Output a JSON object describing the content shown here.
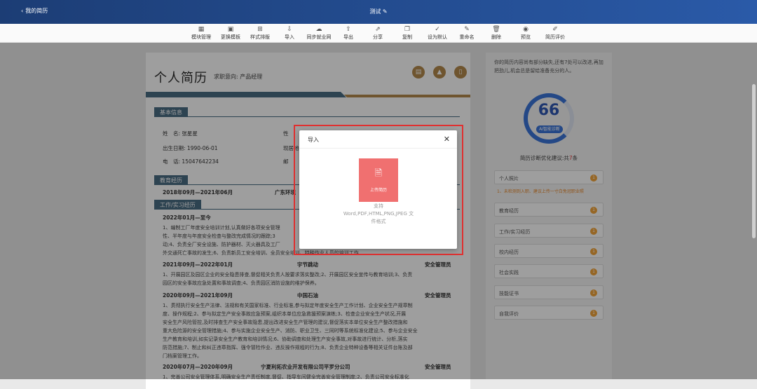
{
  "topbar": {
    "back_label": "我的简历",
    "title": "测试"
  },
  "toolbar": {
    "items": [
      {
        "label": "模块管理",
        "icon": "grid-icon"
      },
      {
        "label": "更换模板",
        "icon": "template-icon"
      },
      {
        "label": "样式排版",
        "icon": "layout-icon"
      },
      {
        "label": "导入",
        "icon": "import-icon"
      },
      {
        "label": "同步就业网",
        "icon": "cloud-sync-icon"
      },
      {
        "label": "导出",
        "icon": "export-icon"
      },
      {
        "label": "分享",
        "icon": "share-icon"
      },
      {
        "label": "复制",
        "icon": "copy-icon"
      },
      {
        "label": "设为默认",
        "icon": "check-icon"
      },
      {
        "label": "重命名",
        "icon": "rename-icon"
      },
      {
        "label": "删除",
        "icon": "delete-icon"
      },
      {
        "label": "预览",
        "icon": "eye-icon"
      },
      {
        "label": "简历评价",
        "icon": "edit-icon"
      }
    ]
  },
  "resume": {
    "name": "个人简历",
    "intent_label": "求职意向:",
    "intent_value": "产品经理",
    "basic_title": "基本信息",
    "name_label": "姓　名:",
    "name_value": "张星星",
    "gender_label": "性",
    "birth_label": "出生日期:",
    "birth_value": "1990-06-01",
    "residence_label": "现居地",
    "phone_label": "电　话:",
    "phone_value": "15047642234",
    "email_label": "邮",
    "edu_title": "教育经历",
    "edu_date": "2018年09月—2021年06月",
    "edu_school": "广东环境",
    "work_title": "工作/实习经历",
    "jobs": [
      {
        "date": "2022年01月—至今",
        "company": "",
        "role": "",
        "lines": [
          "1、编制工厂年度安全培训计划,认真做好各项安全管理",
          "性、半年度与年度安全检查与整改完成情况的跟踪;3",
          "动;4、负责全厂安全设施、防护器材、灭火器具及工厂",
          "外交通死亡事故的发生;6、负责新员工安全培训、全员安全培训、特种作业人员的培训工作"
        ]
      },
      {
        "date": "2021年09月—2022年01月",
        "company": "宇节跳动",
        "role": "安全管理员",
        "lines": [
          "1、开展园区及园区企业的安全隐患排查,督促相关负责人按要求落实整改;2、开展园区安全宣传与教育培训;3、负责",
          "园区的安全事故应急处置和事故调查;4、负责园区消防设施的维护保养。"
        ]
      },
      {
        "date": "2020年09月—2021年09月",
        "company": "中国石油",
        "role": "安全管理员",
        "lines": [
          "1、贯彻执行安全生产法律、法规和有关国家标准、行业标准,参与拟定年度安全生产工作计划、企业安全生产规章制",
          "度、操作规程;2、参与拟定生产安全事故应急预案,组织本单位应急救援预案演练;3、检查企业安全生产状况,开展",
          "安全生产风险管控,及时排查生产安全事故隐患,提出改进安全生产管理的建议,督促落实本单位安全生产整改措施和",
          "重大危险源的安全管理措施;4、参与实施企业安全生产、消防、职业卫生、三同时等系统标准化建设;5、参与企业安全",
          "生产教育和培训,如实记录安全生产教育和培训情况;6、协助调查和处理生产安全事故,对事故进行统计、分析,落实",
          "防范措施;7、制止和纠正违章指挥、强令冒险作业、违反操作规程的行为;8、负责企业特种设备等相关证件台账及部",
          "门档案管理工作。"
        ]
      },
      {
        "date": "2020年07月—2020年09月",
        "company": "宁夏利拓农业开发有限公司平罗分公司",
        "role": "安全管理员",
        "lines": [
          "1、完善公司安全管理体系,明确安全生产责任制度,督促、指导车间健全完善安全管理制度;2、负责公司安全标准化"
        ]
      }
    ]
  },
  "sidebar": {
    "tip": "你的简历内容尚有部分缺失,还有7处可以改进,再加把劲儿,机会总是留给准备充分的人。",
    "score": "66",
    "ai_tag": "AI智能诊断",
    "advice_prefix": "简历诊断优化建议:共",
    "advice_count": "7",
    "advice_suffix": "条",
    "warning": "1、未检测到入职、建议上传一寸白免冠职业照",
    "items": [
      {
        "label": "个人照片",
        "count": "1"
      },
      {
        "label": "教育经历",
        "count": "1"
      },
      {
        "label": "工作/实习经历",
        "count": "1"
      },
      {
        "label": "校内经历",
        "count": "1"
      },
      {
        "label": "社会实践",
        "count": "1"
      },
      {
        "label": "技能证书",
        "count": "1"
      },
      {
        "label": "自我评价",
        "count": "1"
      }
    ]
  },
  "modal": {
    "title": "导入",
    "upload_label": "上传简历",
    "formats_line1": "支持",
    "formats_line2": "Word,PDF,HTML,PNG,JPEG 文",
    "formats_line3": "件格式"
  }
}
